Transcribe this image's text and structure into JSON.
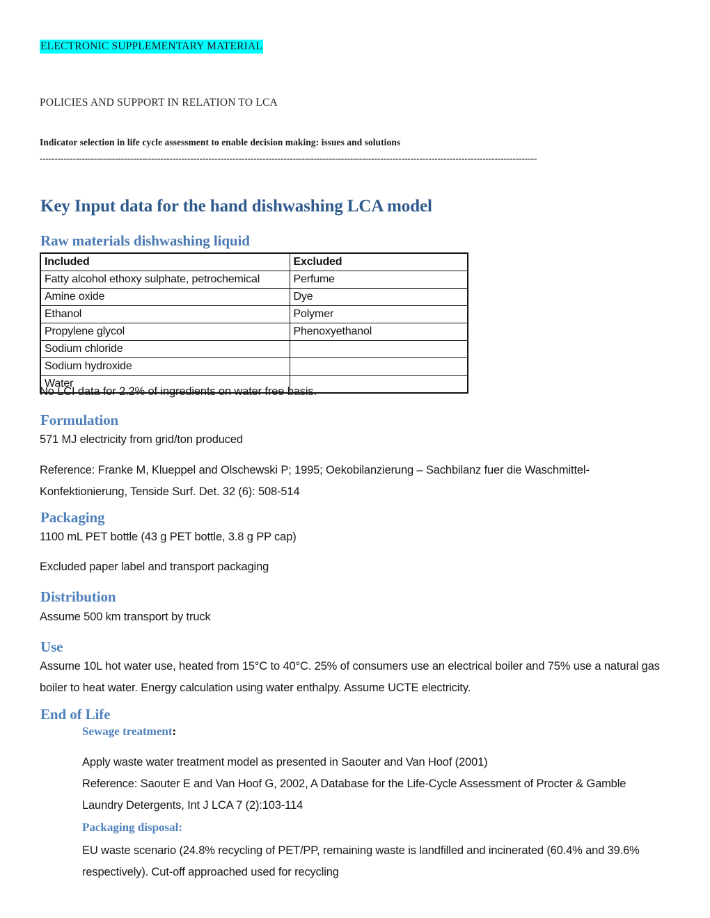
{
  "running_head": {
    "esm_label": "ELECTRONIC SUPPLEMENTARY MATERIAL",
    "section_label": "POLICIES AND SUPPORT IN RELATION TO LCA",
    "article_title": "Indicator selection in life cycle assessment to enable decision making: issues and solutions",
    "rule": "---------------------------------------------------------------------------------------------------------------------------------------------------------------------"
  },
  "document": {
    "title": "Key Input data for the hand dishwashing LCA model"
  },
  "raw_materials": {
    "heading": "Raw materials dishwashing liquid",
    "table": {
      "headers": [
        "Included",
        "Excluded"
      ],
      "rows": [
        [
          "Fatty alcohol ethoxy sulphate, petrochemical",
          "Perfume"
        ],
        [
          "Amine oxide",
          "Dye"
        ],
        [
          "Ethanol",
          "Polymer"
        ],
        [
          "Propylene glycol",
          "Phenoxyethanol"
        ],
        [
          "Sodium chloride",
          ""
        ],
        [
          "Sodium hydroxide",
          ""
        ],
        [
          "Water",
          ""
        ]
      ]
    },
    "note": "No LCI data for 2.2% of ingredients on water free basis."
  },
  "formulation": {
    "heading": "Formulation",
    "electricity": "571 MJ electricity from grid/ton produced",
    "reference": "Reference: Franke M, Klueppel and Olschewski P; 1995; Oekobilanzierung – Sachbilanz fuer die Waschmittel-Konfektionierung, Tenside Surf. Det. 32 (6): 508-514"
  },
  "packaging": {
    "heading": "Packaging",
    "bottle": "1100 mL PET bottle (43 g PET bottle, 3.8 g PP cap)",
    "excluded": "Excluded paper label and transport packaging"
  },
  "distribution": {
    "heading": "Distribution",
    "transport": "Assume 500 km transport by truck"
  },
  "use": {
    "heading": "Use",
    "description": "Assume 10L hot water use, heated from 15°C to 40°C. 25% of consumers use an electrical boiler and 75% use a natural gas boiler to heat water. Energy calculation using water enthalpy. Assume UCTE electricity."
  },
  "end_of_life": {
    "heading": "End of Life",
    "sewage": {
      "label": "Sewage treatment",
      "colon": ":",
      "model": "Apply waste water treatment model as presented in Saouter and Van Hoof (2001)",
      "reference": "Reference: Saouter E and Van Hoof G, 2002, A Database for the Life-Cycle Assessment of Procter & Gamble Laundry Detergents, Int J LCA 7 (2):103-114"
    },
    "packaging_disposal": {
      "label": "Packaging disposal:",
      "text": "EU waste scenario (24.8% recycling of PET/PP, remaining waste is landfilled and incinerated (60.4% and 39.6% respectively). Cut-off approached used for recycling"
    }
  },
  "colors": {
    "highlight": "#00ffff",
    "title_blue": "#2e5a8c",
    "subheading_blue": "#4a7ab3",
    "section_blue": "#4f81bd",
    "body_text": "#171717"
  }
}
